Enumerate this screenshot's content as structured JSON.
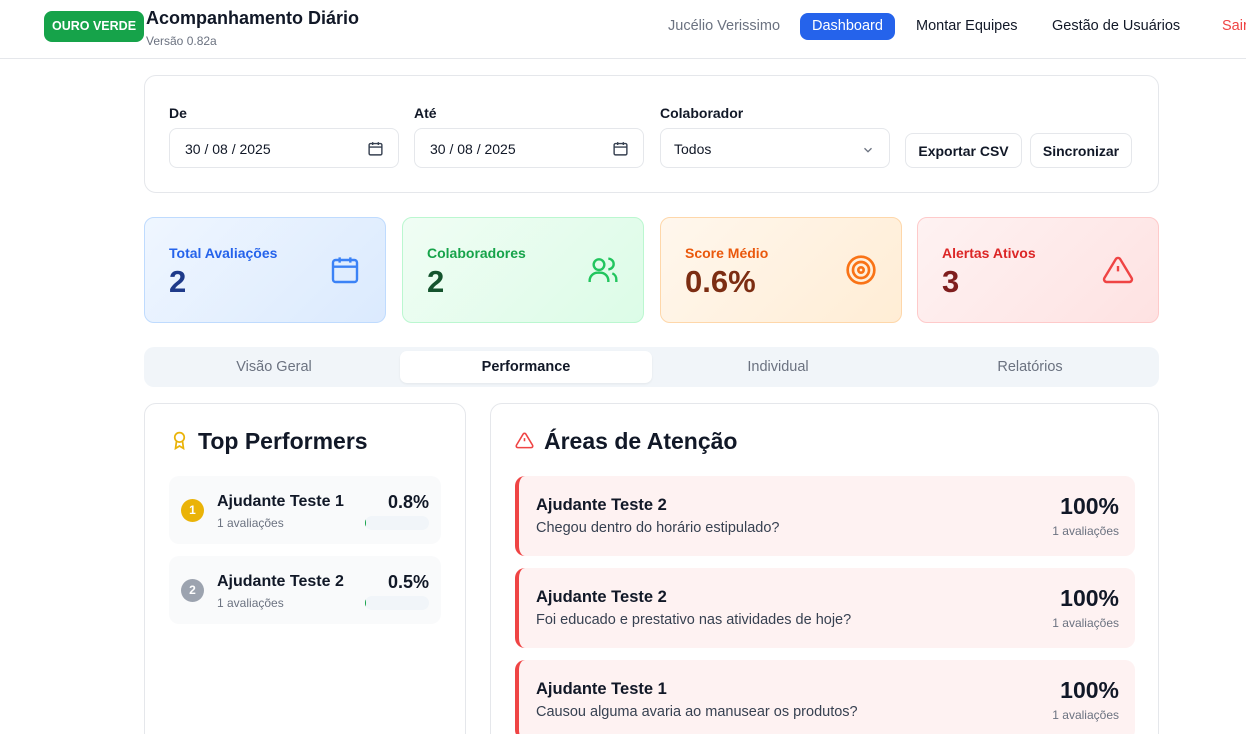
{
  "header": {
    "brand": "OURO VERDE",
    "title": "Acompanhamento Diário",
    "version": "Versão 0.82a",
    "nav": {
      "user": "Jucélio Verissimo",
      "dashboard": "Dashboard",
      "teams": "Montar Equipes",
      "users": "Gestão de Usuários",
      "exit": "Sair"
    }
  },
  "filters": {
    "from_label": "De",
    "from_value": "30 / 08 / 2025",
    "to_label": "Até",
    "to_value": "30 / 08 / 2025",
    "collaborator_label": "Colaborador",
    "collaborator_value": "Todos",
    "export_label": "Exportar CSV",
    "sync_label": "Sincronizar"
  },
  "stats": [
    {
      "label": "Total Avaliações",
      "value": "2",
      "icon": "calendar-icon"
    },
    {
      "label": "Colaboradores",
      "value": "2",
      "icon": "users-icon"
    },
    {
      "label": "Score Médio",
      "value": "0.6%",
      "icon": "target-icon"
    },
    {
      "label": "Alertas Ativos",
      "value": "3",
      "icon": "alert-triangle-icon"
    }
  ],
  "tabs": [
    {
      "label": "Visão Geral",
      "active": false
    },
    {
      "label": "Performance",
      "active": true
    },
    {
      "label": "Individual",
      "active": false
    },
    {
      "label": "Relatórios",
      "active": false
    }
  ],
  "top_performers": {
    "title": "Top Performers",
    "items": [
      {
        "rank": "1",
        "name": "Ajudante Teste 1",
        "count": "1 avaliações",
        "score": "0.8%",
        "fill": 0.008
      },
      {
        "rank": "2",
        "name": "Ajudante Teste 2",
        "count": "1 avaliações",
        "score": "0.5%",
        "fill": 0.005
      }
    ]
  },
  "attention": {
    "title": "Áreas de Atenção",
    "items": [
      {
        "name": "Ajudante Teste 2",
        "question": "Chegou dentro do horário estipulado?",
        "percent": "100%",
        "count": "1 avaliações"
      },
      {
        "name": "Ajudante Teste 2",
        "question": "Foi educado e prestativo nas atividades de hoje?",
        "percent": "100%",
        "count": "1 avaliações"
      },
      {
        "name": "Ajudante Teste 1",
        "question": "Causou alguma avaria ao manusear os produtos?",
        "percent": "100%",
        "count": "1 avaliações"
      }
    ]
  },
  "colors": {
    "accent": "#2563eb",
    "brand": "#16a34a",
    "danger": "#ef4444",
    "gold": "#eab308",
    "silver": "#9ca3af"
  }
}
